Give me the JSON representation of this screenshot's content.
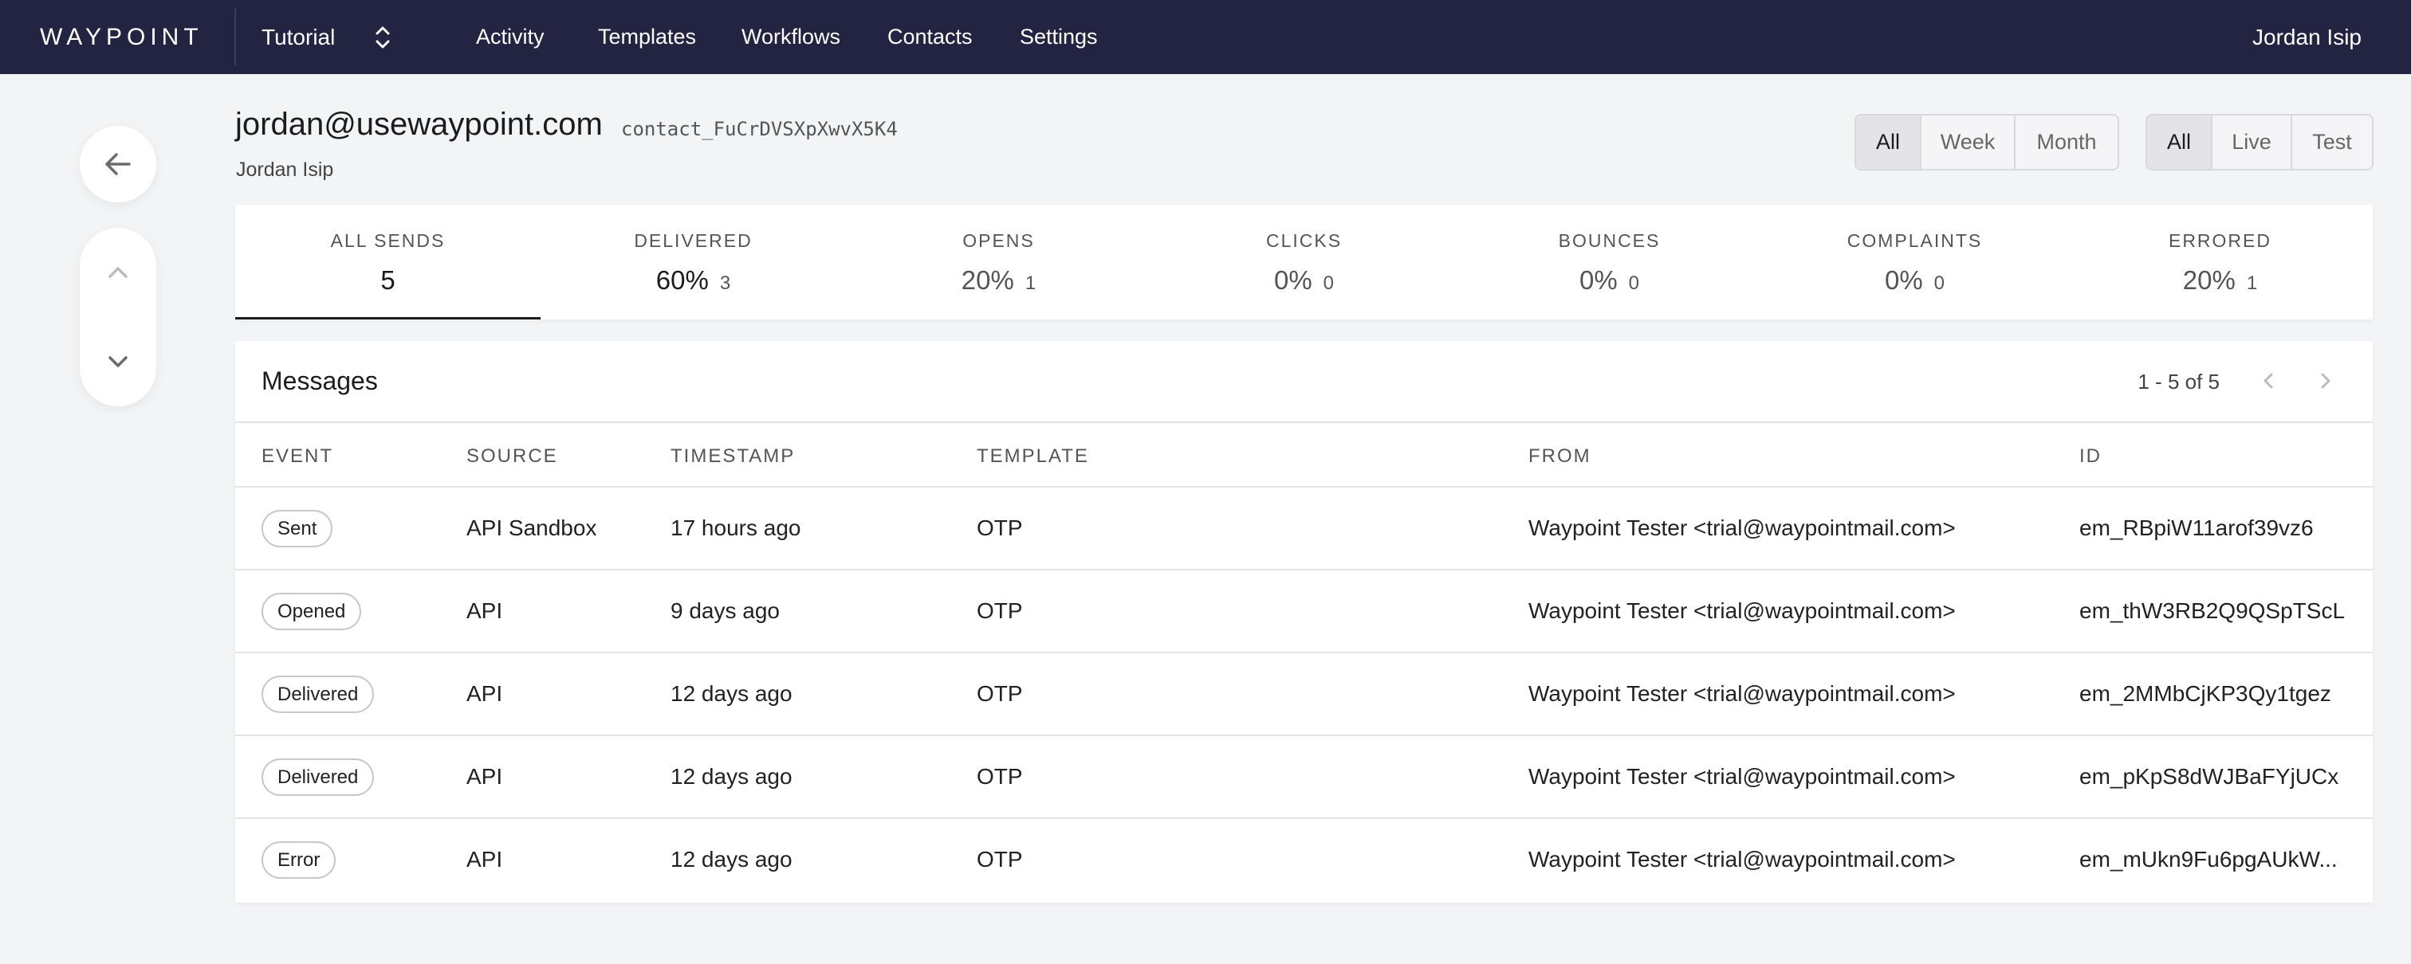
{
  "nav": {
    "brand": "WAYPOINT",
    "workspace": "Tutorial",
    "links": [
      "Activity",
      "Templates",
      "Workflows",
      "Contacts",
      "Settings"
    ],
    "user": "Jordan Isip",
    "colors": {
      "background": "#232442",
      "text": "#ffffff"
    }
  },
  "sidebar": {
    "back_icon": "arrow-left-icon",
    "prev_icon": "chevron-up-icon",
    "next_icon": "chevron-down-icon",
    "prev_disabled": true
  },
  "contact": {
    "email": "jordan@usewaypoint.com",
    "id": "contact_FuCrDVSXpXwvX5K4",
    "name": "Jordan Isip"
  },
  "filters": {
    "time": {
      "options": [
        "All",
        "Week",
        "Month"
      ],
      "selected": "All"
    },
    "environment": {
      "options": [
        "All",
        "Live",
        "Test"
      ],
      "selected": "All"
    }
  },
  "stats": [
    {
      "label": "ALL SENDS",
      "value": "5",
      "count": "",
      "active": true
    },
    {
      "label": "DELIVERED",
      "value": "60%",
      "count": "3",
      "emphasized": true
    },
    {
      "label": "OPENS",
      "value": "20%",
      "count": "1"
    },
    {
      "label": "CLICKS",
      "value": "0%",
      "count": "0"
    },
    {
      "label": "BOUNCES",
      "value": "0%",
      "count": "0"
    },
    {
      "label": "COMPLAINTS",
      "value": "0%",
      "count": "0"
    },
    {
      "label": "ERRORED",
      "value": "20%",
      "count": "1"
    }
  ],
  "messages": {
    "title": "Messages",
    "pagination": {
      "text": "1 - 5 of 5",
      "prev_icon": "chevron-left-icon",
      "next_icon": "chevron-right-icon"
    },
    "columns": [
      "EVENT",
      "SOURCE",
      "TIMESTAMP",
      "TEMPLATE",
      "FROM",
      "ID"
    ],
    "rows": [
      {
        "event": "Sent",
        "source": "API Sandbox",
        "timestamp": "17 hours ago",
        "template": "OTP",
        "from": "Waypoint Tester <trial@waypointmail.com>",
        "id": "em_RBpiW11arof39vz6"
      },
      {
        "event": "Opened",
        "source": "API",
        "timestamp": "9 days ago",
        "template": "OTP",
        "from": "Waypoint Tester <trial@waypointmail.com>",
        "id": "em_thW3RB2Q9QSpTScL"
      },
      {
        "event": "Delivered",
        "source": "API",
        "timestamp": "12 days ago",
        "template": "OTP",
        "from": "Waypoint Tester <trial@waypointmail.com>",
        "id": "em_2MMbCjKP3Qy1tgez"
      },
      {
        "event": "Delivered",
        "source": "API",
        "timestamp": "12 days ago",
        "template": "OTP",
        "from": "Waypoint Tester <trial@waypointmail.com>",
        "id": "em_pKpS8dWJBaFYjUCx"
      },
      {
        "event": "Error",
        "source": "API",
        "timestamp": "12 days ago",
        "template": "OTP",
        "from": "Waypoint Tester <trial@waypointmail.com>",
        "id": "em_mUkn9Fu6pgAUkW..."
      }
    ]
  }
}
